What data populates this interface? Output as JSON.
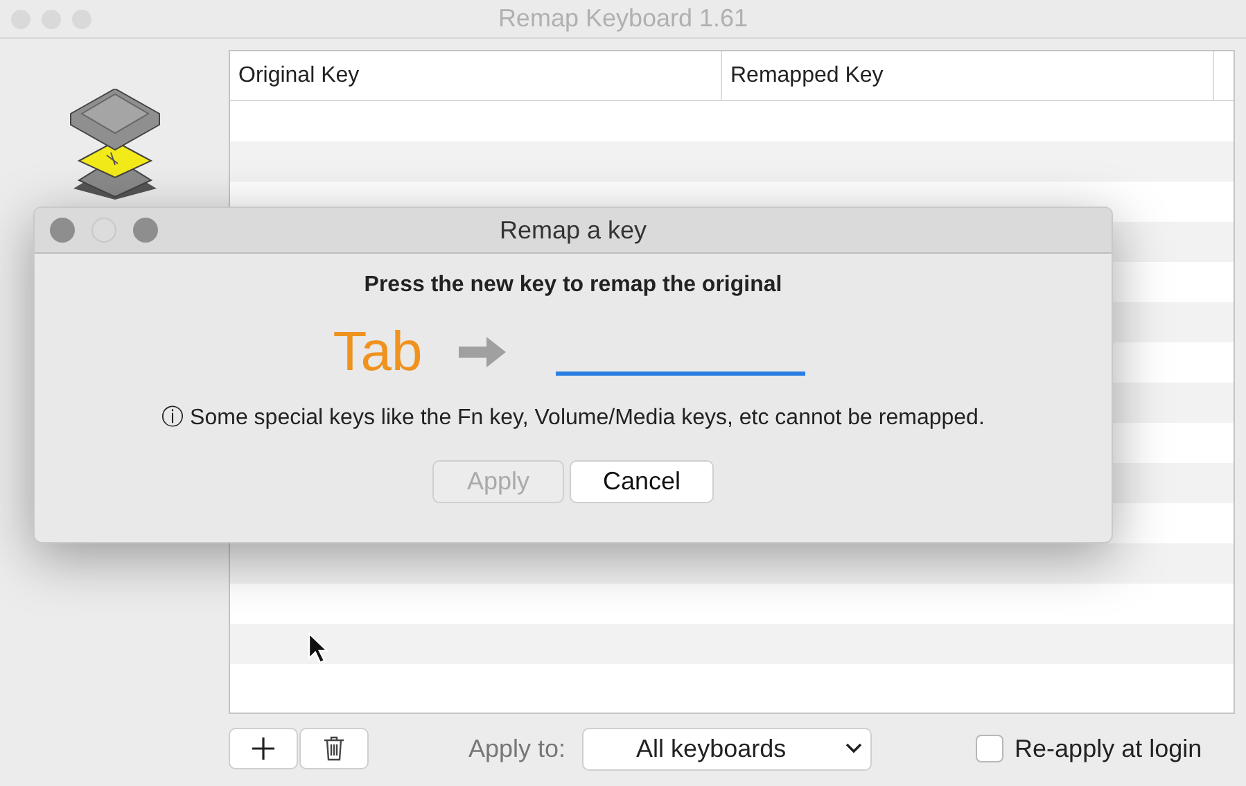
{
  "window": {
    "title": "Remap Keyboard 1.61",
    "active": false
  },
  "table": {
    "columns": [
      "Original Key",
      "Remapped Key"
    ]
  },
  "bottom_bar": {
    "apply_to_label": "Apply to:",
    "apply_to_value": "All keyboards",
    "reapply": {
      "label": "Re-apply at login",
      "checked": false
    }
  },
  "dialog": {
    "title": "Remap a key",
    "heading": "Press the new key to remap the original",
    "original_key": "Tab",
    "note": "ⓘ Some special keys like the Fn key, Volume/Media keys, etc cannot be remapped.",
    "buttons": [
      {
        "label": "Apply",
        "disabled": true
      },
      {
        "label": "Cancel",
        "disabled": false
      }
    ]
  }
}
